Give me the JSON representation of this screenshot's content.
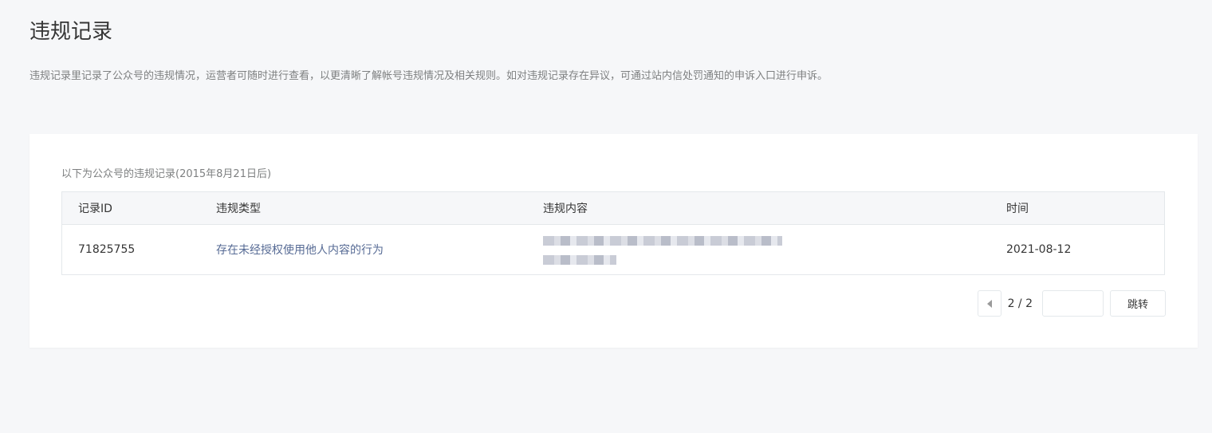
{
  "page": {
    "title": "违规记录",
    "description": "违规记录里记录了公众号的违规情况，运营者可随时进行查看，以更清晰了解帐号违规情况及相关规则。如对违规记录存在异议，可通过站内信处罚通知的申诉入口进行申诉。"
  },
  "records": {
    "caption": "以下为公众号的违规记录(2015年8月21日后)",
    "columns": [
      "记录ID",
      "违规类型",
      "违规内容",
      "时间"
    ],
    "rows": [
      {
        "id": "71825755",
        "type": "存在未经授权使用他人内容的行为",
        "date": "2021-08-12"
      }
    ]
  },
  "pagination": {
    "page_indicator": "2 / 2",
    "jump_input_placeholder": "",
    "jump_label": "跳转"
  },
  "colors": {
    "background": "#f6f7f9",
    "link": "#576b95",
    "border": "#e4e8eb"
  }
}
